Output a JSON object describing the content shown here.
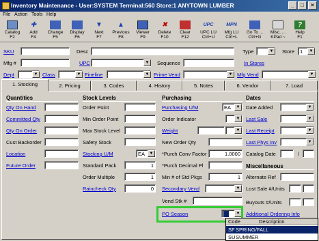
{
  "window": {
    "title": "Inventory Maintenance - User:SYSTEM Terminal:560 Store:1 ANYTOWN LUMBER"
  },
  "menu": [
    "File",
    "Action",
    "Tools",
    "Help"
  ],
  "toolbar": [
    {
      "label": "Catalog",
      "key": "F2",
      "icon": "catalog-icon"
    },
    {
      "label": "Add",
      "key": "F4",
      "icon": "add-icon"
    },
    {
      "label": "Change",
      "key": "F5",
      "icon": "change-icon"
    },
    {
      "label": "Display",
      "key": "F6",
      "icon": "display-icon"
    },
    {
      "label": "Next",
      "key": "F7",
      "icon": "next-icon"
    },
    {
      "label": "Previous",
      "key": "F8",
      "icon": "previous-icon"
    },
    {
      "label": "Viewer",
      "key": "F9",
      "icon": "viewer-icon"
    },
    {
      "label": "Delete",
      "key": "F10",
      "icon": "delete-icon"
    },
    {
      "label": "Clear",
      "key": "F12",
      "icon": "clear-icon"
    },
    {
      "label": "UPC LU",
      "key": "Ctrl+U",
      "icon": "upc-icon",
      "glyph": "UPC"
    },
    {
      "label": "Mfg LU",
      "key": "Ctrl+L",
      "icon": "mpn-icon",
      "glyph": "MPN"
    },
    {
      "label": "Go To ...",
      "key": "Ctrl+G",
      "icon": "goto-icon"
    },
    {
      "label": "Misc. ...",
      "key": "KPad ~",
      "icon": "misc-icon"
    },
    {
      "label": "Help",
      "key": "F1",
      "icon": "help-icon"
    }
  ],
  "header": {
    "sku": "SKU",
    "desc": "Desc",
    "type": "Type",
    "store": "Store",
    "store_value": "1",
    "mfg": "Mfg #",
    "upc": "UPC",
    "sequence": "Sequence",
    "in_stores": "In Stores",
    "dept": "Dept",
    "class": "Class",
    "fineline": "Fineline",
    "prime_vend": "Prime Vend",
    "mfg_vend": "Mfg Vend"
  },
  "tabs": [
    "1. Stocking",
    "2. Pricing",
    "3. Codes",
    "4. History",
    "5. Notes",
    "6. Vendor",
    "7. Load"
  ],
  "quantities": {
    "title": "Quantities",
    "on_hand": "Qty On Hand",
    "committed": "Committed Qty",
    "on_order": "Qty On Order",
    "backorder": "Cust Backorder",
    "location": "Location",
    "future_order": "Future Order"
  },
  "stock_levels": {
    "title": "Stock Levels",
    "order_point": "Order Point",
    "min_order_point": "Min Order Point",
    "max_stock": "Max Stock Level",
    "safety_stock": "Safety Stock",
    "stocking_um": "Stocking U/M",
    "stocking_um_value": "EA",
    "standard_pack": "Standard Pack",
    "standard_pack_value": "1",
    "order_multiple": "Order Multiple",
    "order_multiple_value": "1",
    "raincheck": "Raincheck Qty",
    "raincheck_value": "0"
  },
  "purchasing": {
    "title": "Purchasing",
    "purchasing_um": "Purchasing U/M",
    "purchasing_um_value": "EA",
    "order_indicator": "Order Indicator",
    "weight": "Weight",
    "new_order_qty": "New Order Qty",
    "conv_factor": "*Purch Conv Factor",
    "conv_factor_value": "1.0000",
    "decimal_pl": "*Purch Decimal Pl",
    "min_std_pkgs": "Min # of Std Pkgs",
    "min_std_pkgs_value": "1",
    "secondary_vend": "Secondary Vend",
    "vend_stk": "Vend Stk #",
    "po_season": "PO Season",
    "additional_info": "Additional Ordering Info"
  },
  "dates": {
    "title": "Dates",
    "date_added": "Date Added",
    "last_sale": "Last Sale",
    "last_receipt": "Last Receipt",
    "last_phys_inv": "Last Phys Inv",
    "catalog_date": "Catalog Date",
    "slash": "/"
  },
  "misc": {
    "title": "Miscellaneous",
    "alternate_ref": "Alternate Ref",
    "lost_sale": "Lost Sale #/Units",
    "buyouts": "Buyouts #/Units"
  },
  "season_dropdown": {
    "col_code": "Code",
    "col_desc": "Description",
    "options": [
      {
        "code": "SF",
        "desc": "SPRING/FALL"
      },
      {
        "code": "SU",
        "desc": "SUMMER"
      }
    ]
  },
  "colors": {
    "highlight": "#33cc33",
    "selected": "#0a246a",
    "link": "#0000cc"
  }
}
